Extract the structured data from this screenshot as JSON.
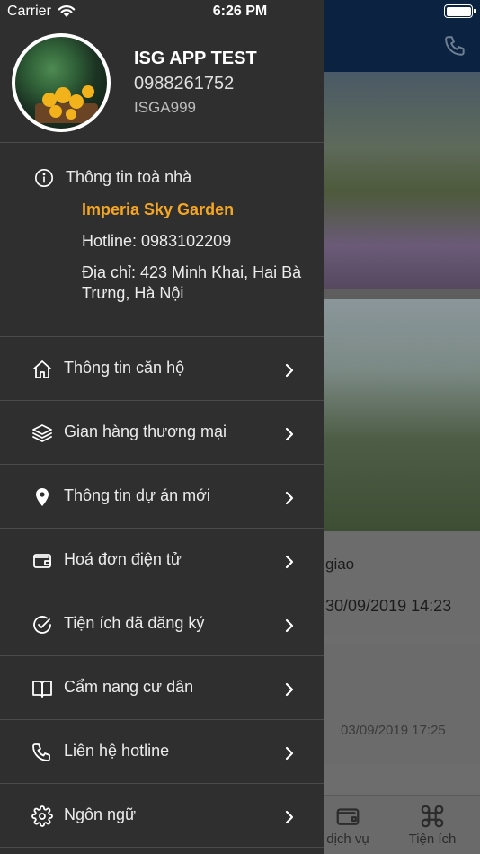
{
  "status_bar": {
    "carrier": "Carrier",
    "time": "6:26 PM"
  },
  "background": {
    "notice_text": "giao",
    "notice_date": "30/09/2019 14:23",
    "card_date": "03/09/2019 17:25",
    "tabs": [
      {
        "label": "dịch vụ",
        "icon": "wallet-icon"
      },
      {
        "label": "Tiện ích",
        "icon": "command-icon"
      }
    ]
  },
  "profile": {
    "name": "ISG APP TEST",
    "phone": "0988261752",
    "code": "ISGA999"
  },
  "building": {
    "title": "Thông tin toà nhà",
    "name": "Imperia Sky Garden",
    "hotline": "Hotline: 0983102209",
    "address": "Địa chỉ: 423 Minh Khai, Hai Bà Trưng, Hà Nội"
  },
  "menu": {
    "items": [
      {
        "label": "Thông tin căn hộ",
        "icon": "home-icon"
      },
      {
        "label": "Gian hàng thương mại",
        "icon": "layers-icon"
      },
      {
        "label": "Thông tin dự án mới",
        "icon": "location-pin-icon"
      },
      {
        "label": "Hoá đơn điện tử",
        "icon": "wallet-icon"
      },
      {
        "label": "Tiện ích đã đăng ký",
        "icon": "check-circle-icon"
      },
      {
        "label": "Cẩm nang cư dân",
        "icon": "book-icon"
      },
      {
        "label": "Liên hệ hotline",
        "icon": "phone-icon"
      },
      {
        "label": "Ngôn ngữ",
        "icon": "gear-icon"
      }
    ]
  },
  "colors": {
    "drawer_bg": "#2f2f2f",
    "accent": "#f4a623",
    "header_bg": "#0b2340"
  }
}
